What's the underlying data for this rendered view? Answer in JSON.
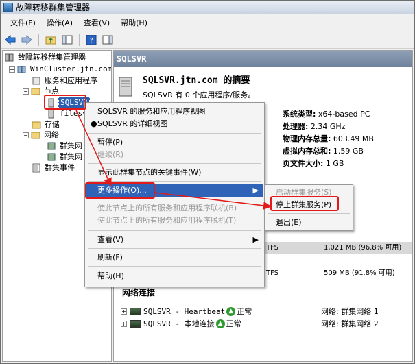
{
  "window": {
    "title": "故障转移群集管理器"
  },
  "menu": [
    "文件(F)",
    "操作(A)",
    "查看(V)",
    "帮助(H)"
  ],
  "tree": {
    "root": "故障转移群集管理器",
    "cluster": "WinCluster.jtn.com",
    "services": "服务和应用程序",
    "nodes": "节点",
    "node1": "SQLSVR",
    "node2": "filesv",
    "storage": "存储",
    "network": "网络",
    "net1": "群集网",
    "net2": "群集网",
    "events": "群集事件"
  },
  "rightpane": {
    "header": "SQLSVR",
    "summary_title": "SQLSVR.jtn.com 的摘要",
    "summary_sub": "SQLSVR 有 0 个应用程序/服务。",
    "props": [
      {
        "label": "系统类型:",
        "value": "x64-based PC"
      },
      {
        "label": "处理器:",
        "value": "2.34 GHz"
      },
      {
        "label": "物理内存总量:",
        "value": "603.49 MB"
      },
      {
        "label": "虚拟内存总和:",
        "value": "1.59 GB"
      },
      {
        "label": "页文件大小:",
        "value": "1 GB"
      }
    ],
    "storage": [
      {
        "fs": "TFS",
        "size": "1,021 MB (96.8% 可用)"
      },
      {
        "fs": "TFS",
        "size": "509 MB (91.8% 可用)"
      }
    ],
    "net_section": "网络连接",
    "net_rows": [
      {
        "name": "SQLSVR - Heartbeat",
        "status": "正常",
        "network": "网络: 群集网络 1"
      },
      {
        "name": "SQLSVR - 本地连接",
        "status": "正常",
        "network": "网络: 群集网络 2"
      }
    ]
  },
  "context_menu": {
    "items": [
      "SQLSVR 的服务和应用程序视图",
      "SQLSVR 的详细视图",
      "暂停(P)",
      "继续(R)",
      "显示此群集节点的关键事件(W)",
      "更多操作(O)...",
      "使此节点上的所有服务和应用程序联机(B)",
      "使此节点上的所有服务和应用程序脱机(T)",
      "查看(V)",
      "刷新(F)",
      "帮助(H)"
    ]
  },
  "submenu": {
    "items": [
      "启动群集服务(S)",
      "停止群集服务(P)",
      "退出(E)"
    ]
  }
}
